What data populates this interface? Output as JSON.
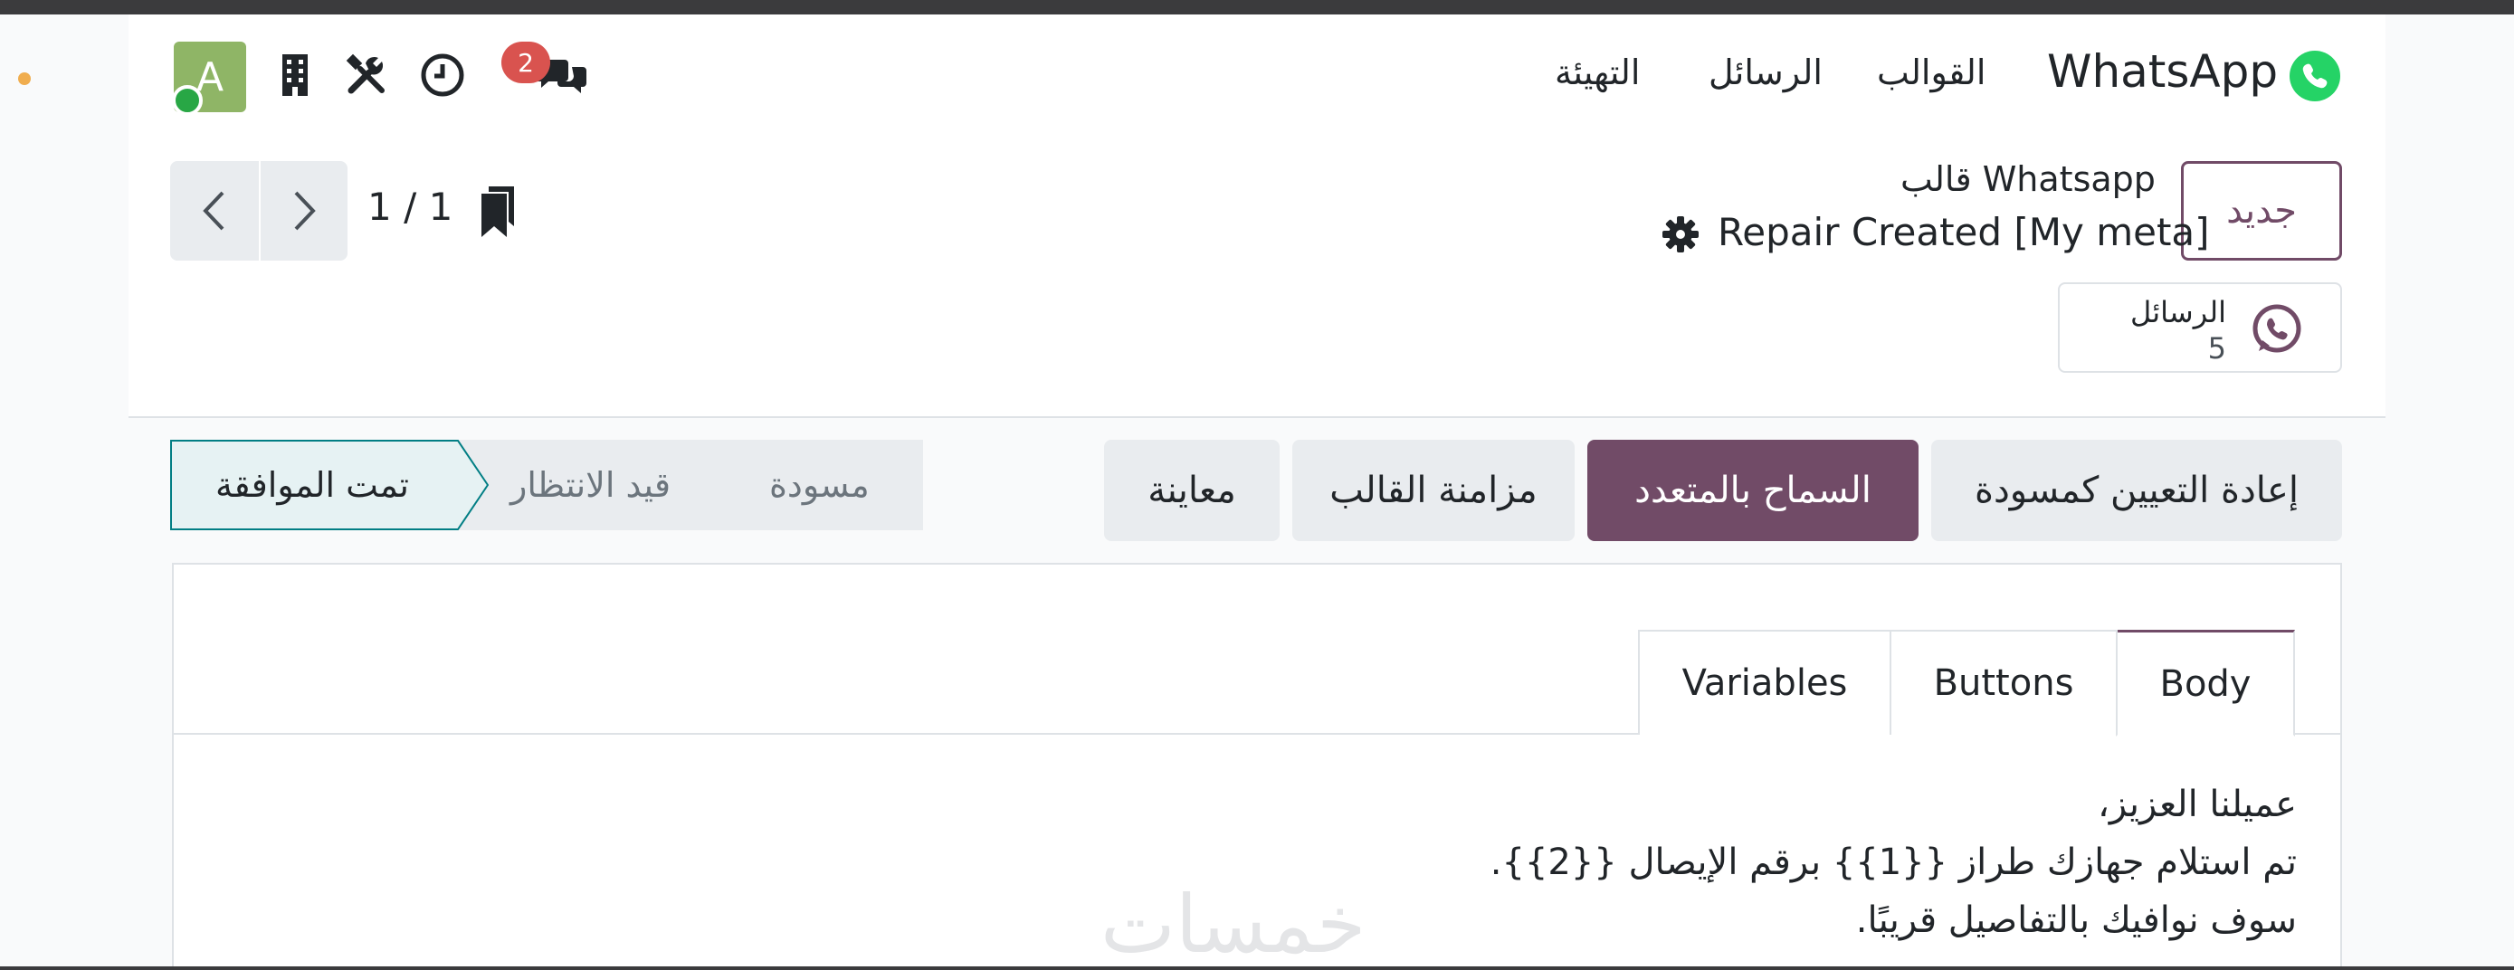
{
  "navbar": {
    "brand": "WhatsApp",
    "menu": [
      "التهيئة",
      "الرسائل",
      "القوالب"
    ],
    "chat_badge": "2",
    "avatar_letter": "A"
  },
  "control_panel": {
    "new_button": "جديد",
    "breadcrumb_parent": "قالب Whatsapp",
    "breadcrumb_current": "Repair Created [My meta]",
    "pager_value": "1 / 1",
    "stat_button": {
      "label": "الرسائل",
      "value": "5"
    }
  },
  "actions": {
    "reset_draft": "إعادة التعيين كمسودة",
    "allow_multi": "السماح بالمتعدد",
    "sync_template": "مزامنة القالب",
    "preview": "معاينة"
  },
  "statusbar": {
    "draft": "مسودة",
    "pending": "قيد الانتظار",
    "approved": "تمت الموافقة"
  },
  "tabs": {
    "body": "Body",
    "buttons": "Buttons",
    "variables": "Variables"
  },
  "body_text": {
    "line1": "عميلنا العزيز،",
    "line2": "تم استلام جهازك طراز {{1}} برقم الإيصال {{2}}.",
    "line3": "سوف نوافيك بالتفاصيل قريبًا."
  },
  "watermark": "خمسات",
  "colors": {
    "primary": "#714b67",
    "whatsapp": "#25d366",
    "badge": "#d9534f",
    "status_approved_bg": "#e6f2f3",
    "status_approved_border": "#017e84"
  }
}
